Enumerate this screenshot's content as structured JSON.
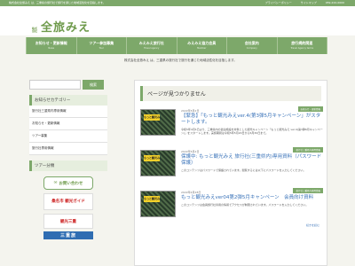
{
  "topbar": {
    "lead": "株式会社全旅みえ は、三重県の旅行社で旅行を通じた地域活性化を目指します。",
    "links": [
      "プライバシーポリシー",
      "サイトマップ",
      "059-222-0000"
    ]
  },
  "header": {
    "corp": "株式会社",
    "name": "全旅みえ"
  },
  "nav": [
    {
      "label": "お知らせ・更新情報",
      "sub": "News"
    },
    {
      "label": "ツアー参加募集",
      "sub": "Tour"
    },
    {
      "label": "みえみえ旅行社",
      "sub": "Travel agency"
    },
    {
      "label": "みえみえ協力会員",
      "sub": "Member"
    },
    {
      "label": "会社案内",
      "sub": "Company"
    },
    {
      "label": "旅行規約関連",
      "sub": "Travel Agency terms"
    }
  ],
  "tagline": "株式会社全旅みえ は、三重県の旅行社で旅行を通じた地域活性化を目指します。",
  "sidebar": {
    "search_button": "検索",
    "cat_heading": "お知らせカテゴリー",
    "categories": [
      "旅行社三重県内専用情報",
      "お知らせ・更新情報",
      "ツアー募集",
      "旅行社専用情報"
    ],
    "tour_heading": "ツアー分類",
    "contact": "お問い合わせ",
    "banner1": "桑名市 観光ガイド",
    "banner2": "観光三重",
    "banner3": "三重旅"
  },
  "main": {
    "page_title": "ページが見つかりません",
    "posts": [
      {
        "tag": "お知らせ・更新情報",
        "date": "2022年5月2日",
        "title": "【緊急】「もっと観光みえver.4(第3弾5月キャンペーン」がスタートします。",
        "excerpt": "令和5年4月1日より、三重県内の宿泊施設を対象とした観光キャンペーン「もっと観光みえ ver.4(第3弾6月キャンペーン)」をスタートします。実施期間は令和5年5月20日から6月30日まで。",
        "thumb_label": "もっと観光みえ"
      },
      {
        "tag": "旅行社三重県内専用情報",
        "date": "2022年5月2日",
        "title": "保護中: もっと観光みえ 旅行社(三重県内)専用資料（パスワード保護）",
        "excerpt": "このコンテンツはパスワードで保護されています。閲覧するには以下にパスワードを入力してください。",
        "thumb_label": "もっと観光みえ"
      },
      {
        "tag": "旅行社三重県内専用情報",
        "date": "2022年4月28日",
        "title": "もっと観光みえver04第2弾5月キャンペーン　会員向け資料",
        "excerpt": "このコンテンツは会員旅行社専用の情報でアクセスが制限されています。パスワードを入力してください。",
        "thumb_label": "もっと観光みえ"
      }
    ],
    "more": "続きを読む"
  }
}
